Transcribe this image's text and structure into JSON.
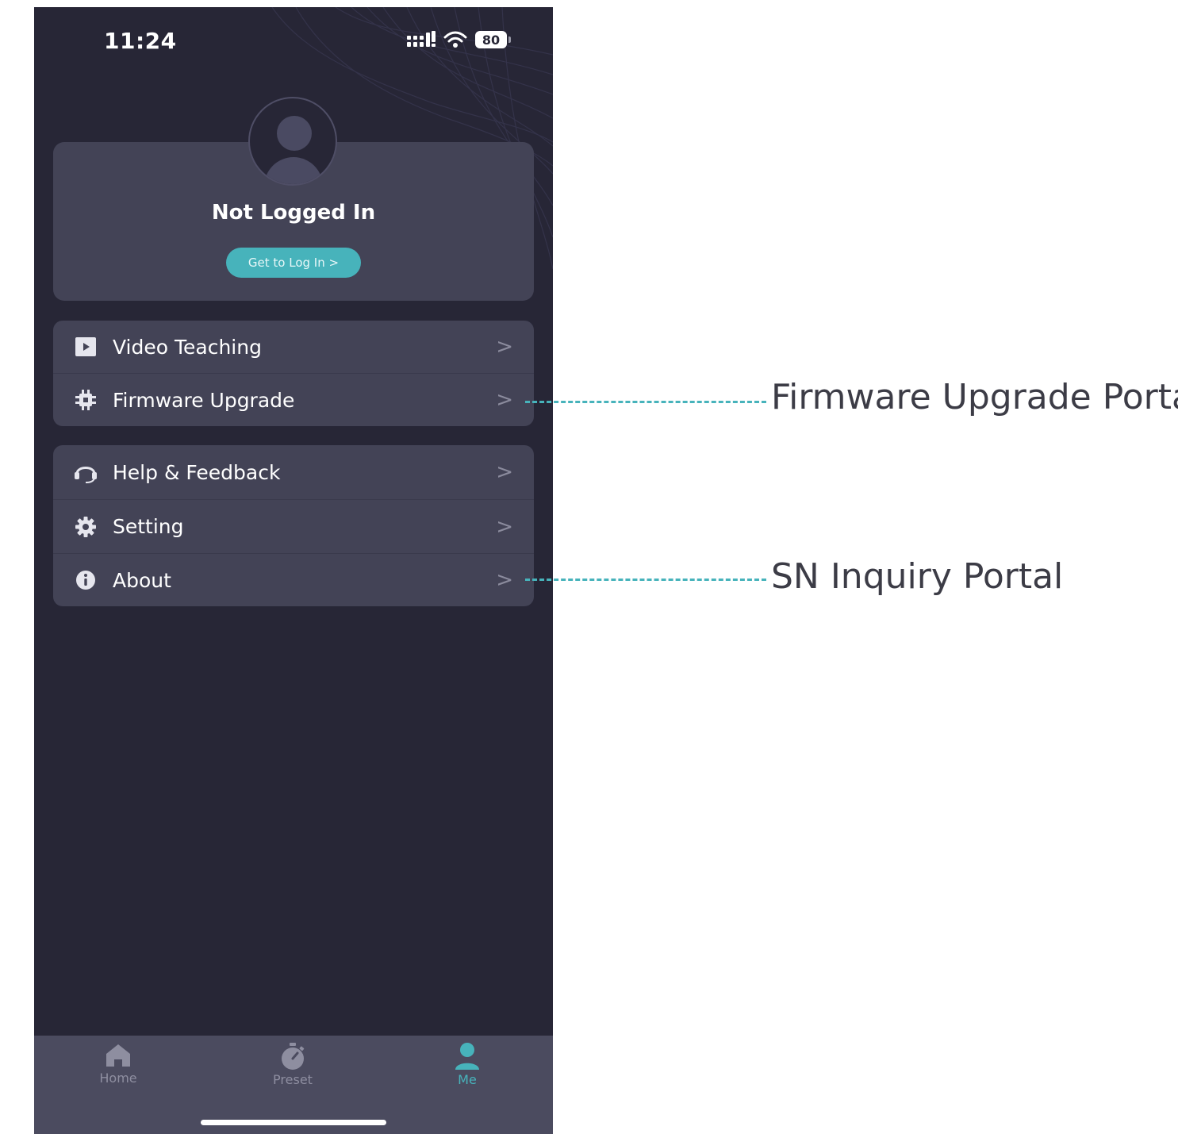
{
  "status_bar": {
    "time": "11:24",
    "battery": "80"
  },
  "profile": {
    "name": "Not Logged In",
    "login_button": "Get to Log In >"
  },
  "menu_groups": [
    [
      {
        "label": "Video Teaching",
        "icon": "video-play-icon"
      },
      {
        "label": "Firmware Upgrade",
        "icon": "chip-icon"
      }
    ],
    [
      {
        "label": "Help & Feedback",
        "icon": "headset-icon"
      },
      {
        "label": "Setting",
        "icon": "gear-icon"
      },
      {
        "label": "About",
        "icon": "info-icon"
      }
    ]
  ],
  "chevron": ">",
  "tabbar": {
    "tabs": [
      {
        "label": "Home",
        "icon": "home-icon",
        "active": false
      },
      {
        "label": "Preset",
        "icon": "stopwatch-icon",
        "active": false
      },
      {
        "label": "Me",
        "icon": "person-icon",
        "active": true
      }
    ]
  },
  "annotations": [
    {
      "text": "Firmware Upgrade Portal",
      "target": "Firmware Upgrade"
    },
    {
      "text": "SN Inquiry Portal",
      "target": "About"
    }
  ],
  "colors": {
    "background": "#272636",
    "card": "#434356",
    "accent": "#47b3bb",
    "tabbar": "#4b4b5f"
  }
}
